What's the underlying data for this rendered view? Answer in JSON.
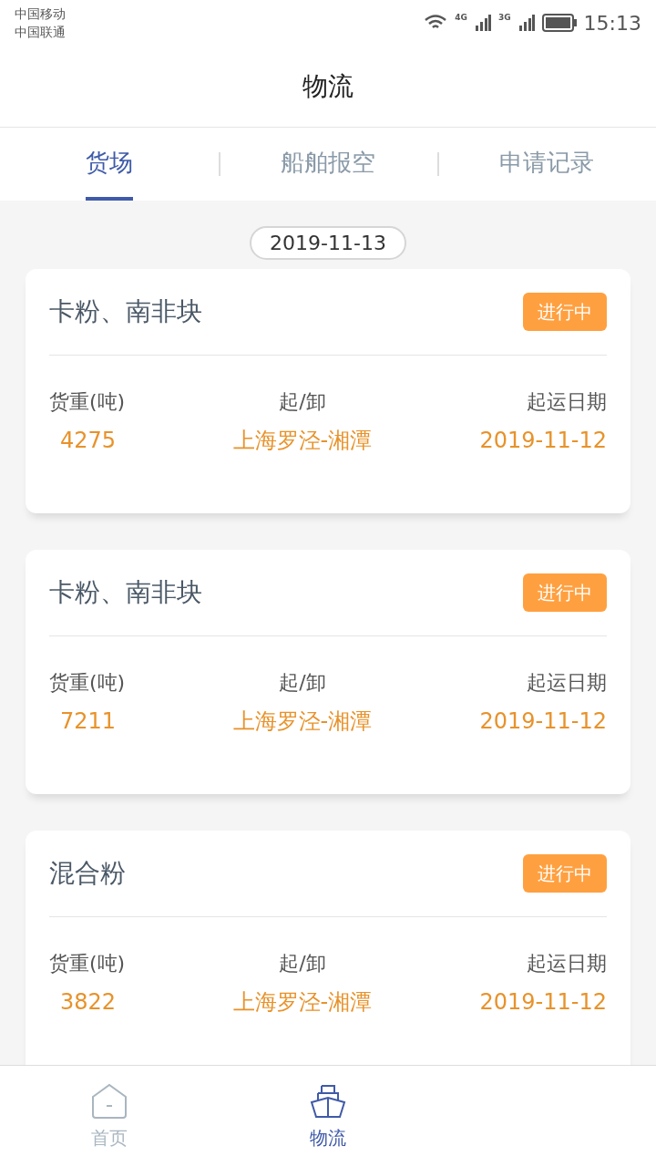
{
  "status_bar": {
    "carriers": [
      "中国移动",
      "中国联通"
    ],
    "network_1": "4G",
    "network_2": "3G",
    "time": "15:13"
  },
  "header": {
    "title": "物流"
  },
  "tabs": [
    {
      "label": "货场",
      "selected": true
    },
    {
      "label": "船舶报空",
      "selected": false
    },
    {
      "label": "申请记录",
      "selected": false
    }
  ],
  "date": "2019-11-13",
  "cards": [
    {
      "title": "卡粉、南非块",
      "status": "进行中",
      "fields": [
        {
          "label": "货重(吨)",
          "value": "4275"
        },
        {
          "label": "起/卸",
          "value": "上海罗泾-湘潭"
        },
        {
          "label": "起运日期",
          "value": "2019-11-12"
        }
      ]
    },
    {
      "title": "卡粉、南非块",
      "status": "进行中",
      "fields": [
        {
          "label": "货重(吨)",
          "value": "7211"
        },
        {
          "label": "起/卸",
          "value": "上海罗泾-湘潭"
        },
        {
          "label": "起运日期",
          "value": "2019-11-12"
        }
      ]
    },
    {
      "title": "混合粉",
      "status": "进行中",
      "fields": [
        {
          "label": "货重(吨)",
          "value": "3822"
        },
        {
          "label": "起/卸",
          "value": "上海罗泾-湘潭"
        },
        {
          "label": "起运日期",
          "value": "2019-11-12"
        }
      ]
    }
  ],
  "bottom_nav": [
    {
      "kind": "home",
      "label": "首页",
      "selected": false
    },
    {
      "kind": "ship",
      "label": "物流",
      "selected": true
    }
  ]
}
